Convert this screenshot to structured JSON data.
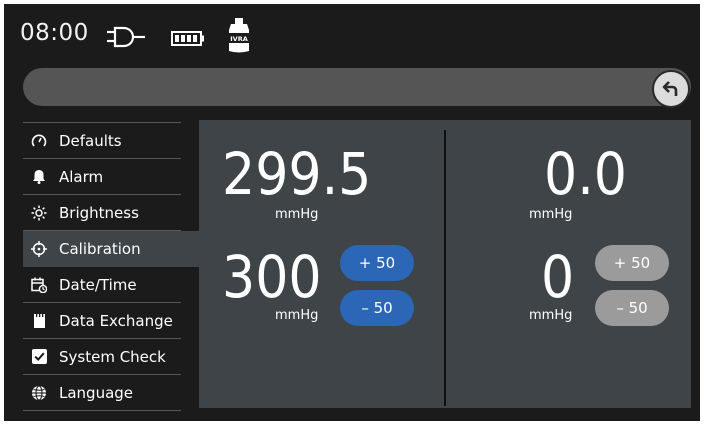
{
  "status_bar": {
    "time": "08:00",
    "icons": [
      "plug-icon",
      "battery-icon",
      "cuff-device-icon"
    ],
    "device_badge": "IVRA"
  },
  "header": {
    "title": "",
    "back_icon": "back-arrow-icon"
  },
  "sidebar": {
    "items": [
      {
        "label": "Defaults",
        "icon": "gauge-icon",
        "active": false
      },
      {
        "label": "Alarm",
        "icon": "bell-icon",
        "active": false
      },
      {
        "label": "Brightness",
        "icon": "sun-icon",
        "active": false
      },
      {
        "label": "Calibration",
        "icon": "crosshair-icon",
        "active": true
      },
      {
        "label": "Date/Time",
        "icon": "calendar-clock-icon",
        "active": false
      },
      {
        "label": "Data Exchange",
        "icon": "sd-card-icon",
        "active": false
      },
      {
        "label": "System Check",
        "icon": "checkbox-icon",
        "active": false
      },
      {
        "label": "Language",
        "icon": "globe-icon",
        "active": false
      }
    ]
  },
  "calibration": {
    "left": {
      "measured": "299.5",
      "measured_unit": "mmHg",
      "setpoint": "300",
      "setpoint_unit": "mmHg",
      "plus_label": "+ 50",
      "minus_label": "– 50",
      "enabled": true
    },
    "right": {
      "measured": "0.0",
      "measured_unit": "mmHg",
      "setpoint": "0",
      "setpoint_unit": "mmHg",
      "plus_label": "+ 50",
      "minus_label": "– 50",
      "enabled": false
    }
  },
  "colors": {
    "background": "#1b1b1b",
    "panel": "#3f4448",
    "button_active": "#2c66b6",
    "button_disabled": "#9b9b9b",
    "title_bar": "#555555"
  }
}
